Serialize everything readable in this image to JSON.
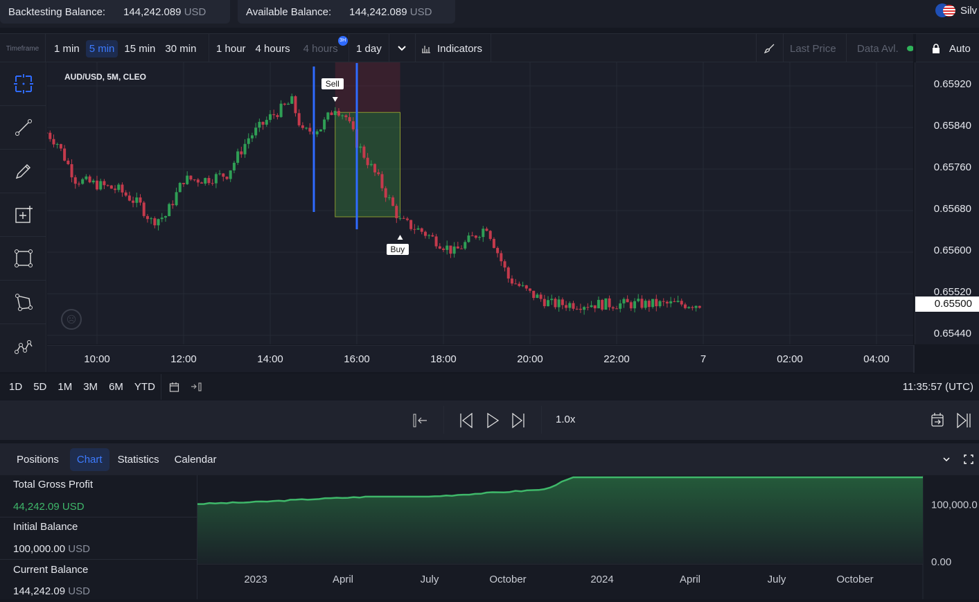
{
  "header": {
    "backtesting_label": "Backtesting Balance:",
    "backtesting_value": "144,242.089",
    "backtesting_unit": "USD",
    "available_label": "Available Balance:",
    "available_value": "144,242.089",
    "available_unit": "USD",
    "user_name": "Silv",
    "flag_icon": "aud-usd-flag-icon"
  },
  "toolbar": {
    "timeframe_label": "Timeframe",
    "timeframes": [
      "1 min",
      "5 min",
      "15 min",
      "30 min"
    ],
    "hours": [
      "1 hour",
      "4 hours"
    ],
    "custom_tf": "4 hours",
    "custom_badge": "3H",
    "day": "1 day",
    "indicators": "Indicators",
    "last_price": "Last Price",
    "data_avl": "Data Avl.",
    "auto": "Auto",
    "active_timeframe": "5 min",
    "accent": "#2f6bff"
  },
  "chart": {
    "symbol_label": "AUD/USD, 5M, CLEO",
    "sell_label": "Sell",
    "buy_label": "Buy",
    "current_price": "0.65500",
    "price_ticks": [
      "0.65920",
      "0.65840",
      "0.65760",
      "0.65680",
      "0.65600",
      "0.65520",
      "0.65440"
    ],
    "time_ticks": [
      "10:00",
      "12:00",
      "14:00",
      "16:00",
      "18:00",
      "20:00",
      "22:00",
      "7",
      "02:00",
      "04:00"
    ],
    "price_path": [
      [
        "08:50",
        0.6583
      ],
      [
        "09:05",
        0.6581
      ],
      [
        "09:30",
        0.6574
      ],
      [
        "10:00",
        0.6573
      ],
      [
        "10:30",
        0.6572
      ],
      [
        "11:00",
        0.6569
      ],
      [
        "11:15",
        0.6566
      ],
      [
        "11:35",
        0.6567
      ],
      [
        "12:00",
        0.6574
      ],
      [
        "12:30",
        0.6574
      ],
      [
        "13:00",
        0.6575
      ],
      [
        "13:30",
        0.6582
      ],
      [
        "14:00",
        0.6586
      ],
      [
        "14:30",
        0.6589
      ],
      [
        "14:45",
        0.6583
      ],
      [
        "15:10",
        0.6584
      ],
      [
        "15:30",
        0.6588
      ],
      [
        "15:45",
        0.6586
      ],
      [
        "16:00",
        0.6581
      ],
      [
        "16:30",
        0.6574
      ],
      [
        "17:00",
        0.6566
      ],
      [
        "17:30",
        0.6564
      ],
      [
        "18:15",
        0.656
      ],
      [
        "19:00",
        0.6565
      ],
      [
        "19:30",
        0.6555
      ],
      [
        "20:00",
        0.6552
      ],
      [
        "20:30",
        0.655
      ],
      [
        "22:00",
        0.655
      ],
      [
        "23:55",
        0.655
      ]
    ],
    "colors": {
      "up": "#2f9e55",
      "down": "#c43a4c",
      "trade_line": "#2f6bff"
    }
  },
  "range": {
    "buttons": [
      "1D",
      "5D",
      "1M",
      "3M",
      "6M",
      "YTD"
    ],
    "clock": "11:35:57 (UTC)"
  },
  "playback": {
    "speed": "1.0x"
  },
  "tabs": {
    "items": [
      "Positions",
      "Chart",
      "Statistics",
      "Calendar"
    ],
    "active": "Chart"
  },
  "stats": [
    {
      "label": "Total Gross Profit",
      "value": "44,242.09 USD",
      "unit": ""
    },
    {
      "label": "Initial Balance",
      "value": "100,000.00",
      "unit": "USD"
    },
    {
      "label": "Current Balance",
      "value": "144,242.09",
      "unit": "USD"
    }
  ],
  "chart_data": {
    "type": "area",
    "x_ticks": [
      "2023",
      "April",
      "July",
      "October",
      "2024",
      "April",
      "July",
      "October"
    ],
    "y_ticks": [
      "100,000.0",
      "0.00"
    ],
    "ylim": [
      0,
      150000
    ],
    "x": [
      "2022-11",
      "2023-01",
      "2023-03",
      "2023-05",
      "2023-07",
      "2023-09",
      "2023-11",
      "2023-12",
      "2024-03",
      "2024-06",
      "2024-09",
      "2024-12"
    ],
    "values": [
      100000,
      103000,
      108000,
      112000,
      112000,
      118000,
      124000,
      144242,
      144242,
      144242,
      144242,
      144242
    ],
    "color": "#3fb86a"
  }
}
